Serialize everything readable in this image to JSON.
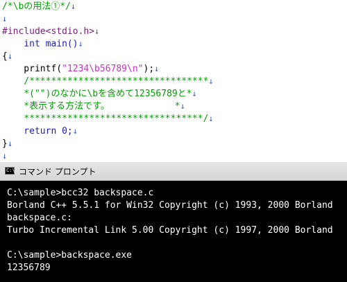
{
  "editor": {
    "lines": [
      {
        "text": "/*\\bの用法①*/",
        "eol": "↓"
      },
      {
        "text": "",
        "eol": "↓"
      },
      {
        "text": "#include<stdio.h>",
        "eol": "↓"
      },
      {
        "text": "    int main()",
        "eol": "↓"
      },
      {
        "text": "{",
        "eol": "↓"
      },
      {
        "pre": "    printf(",
        "str": "\"1234\\b56789\\n\"",
        "post": ");",
        "eol": "↓"
      },
      {
        "text": "    /*********************************",
        "eol": "↓"
      },
      {
        "text": "    *(\"\")のなかに\\bを含めて12356789と*",
        "eol": "↓"
      },
      {
        "text": "    *表示する方法です。            *",
        "eol": "↓"
      },
      {
        "text": "    *********************************/",
        "eol": "↓"
      },
      {
        "text": "    return 0;",
        "eol": "↓"
      },
      {
        "text": "}",
        "eol": "↓"
      },
      {
        "text": "",
        "eol": "↓"
      }
    ]
  },
  "console": {
    "title": "コマンド プロンプト",
    "icon_label": "C:\\",
    "lines": [
      "C:\\sample>bcc32 backspace.c",
      "Borland C++ 5.5.1 for Win32 Copyright (c) 1993, 2000 Borland",
      "backspace.c:",
      "Turbo Incremental Link 5.00 Copyright (c) 1997, 2000 Borland",
      "",
      "C:\\sample>backspace.exe",
      "12356789"
    ]
  }
}
